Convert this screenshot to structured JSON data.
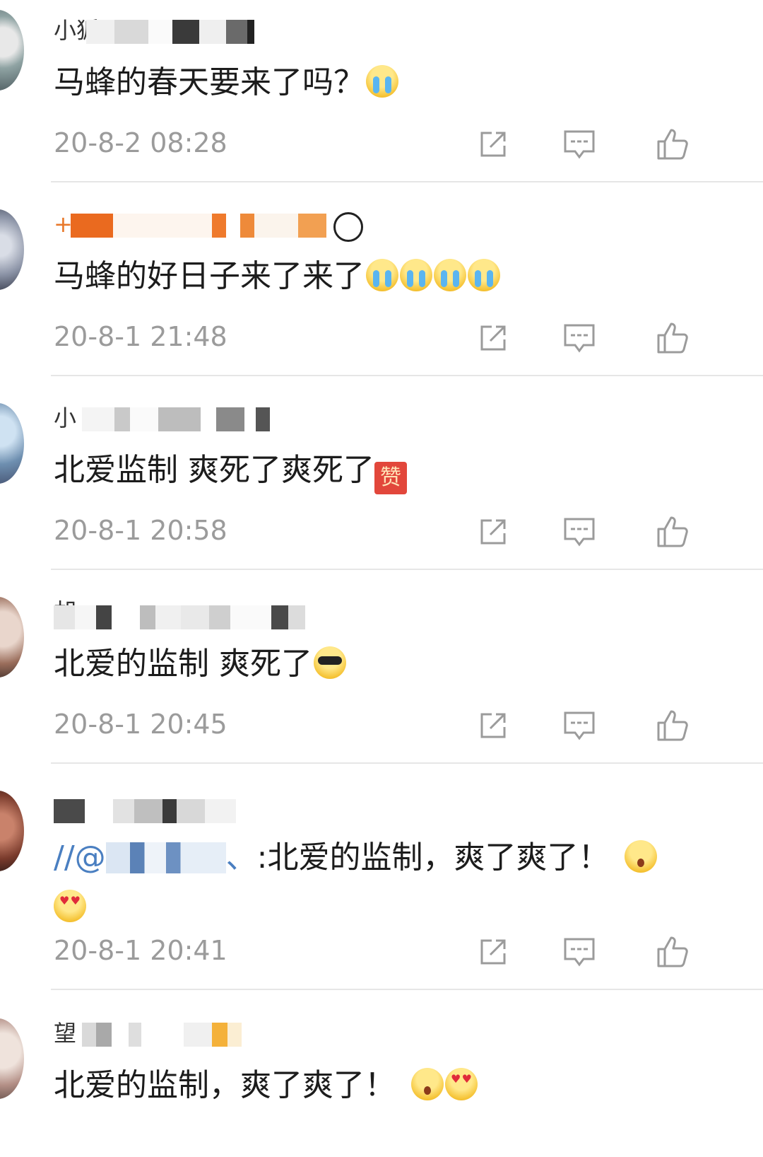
{
  "colors": {
    "text": "#1c1c1c",
    "meta": "#9b9b9b",
    "divider": "#e6e6e6",
    "link": "#4a7fc1"
  },
  "comments": [
    {
      "username": "小狐",
      "text": "马蜂的春天要来了吗？",
      "emojis": [
        "cry-emoji"
      ],
      "time": "20-8-2 08:28"
    },
    {
      "username": "+",
      "text": "马蜂的好日子来了来了",
      "emojis": [
        "cry-emoji",
        "cry-emoji",
        "cry-emoji",
        "cry-emoji"
      ],
      "time": "20-8-1 21:48"
    },
    {
      "username": "小",
      "text": "北爱监制 爽死了爽死了",
      "emojis": [
        "zan-emoji"
      ],
      "zan": "赞",
      "time": "20-8-1 20:58"
    },
    {
      "username": "胡",
      "text": "北爱的监制 爽死了",
      "emojis": [
        "cool-emoji"
      ],
      "time": "20-8-1 20:45"
    },
    {
      "username": "",
      "prefix": "//@",
      "mention_suffix": "、",
      "text": ":北爱的监制，爽了爽了！",
      "emojis": [
        "shock-emoji",
        "love-emoji"
      ],
      "time": "20-8-1 20:41"
    },
    {
      "username": "望",
      "text": "北爱的监制，爽了爽了！",
      "emojis": [
        "shock-emoji",
        "love-emoji"
      ],
      "time": ""
    }
  ],
  "icons": {
    "repost": "repost-icon",
    "comment": "comment-icon",
    "like": "like-icon"
  }
}
